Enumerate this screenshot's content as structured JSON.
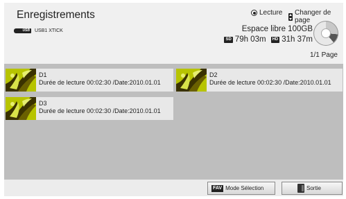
{
  "header": {
    "title": "Enregistrements",
    "hint_play": {
      "icon": "play-circle-icon",
      "label": "Lecture"
    },
    "hint_page": {
      "icon": "page-up-down-icon",
      "label": "Changer de page"
    },
    "usb": {
      "icon": "usb-icon",
      "icon_text": "USB",
      "label": "USB1 XTICK"
    },
    "storage": {
      "free_space": "Espace libre 100GB",
      "sd_badge": "SD",
      "sd_time": "79h 03m",
      "hd_badge": "HD",
      "hd_time": "31h 37m",
      "icon": "disk-usage-icon"
    },
    "page_indicator": "1/1 Page"
  },
  "recordings": [
    {
      "name": "D1",
      "detail": "Durée de lecture 00:02:30 /Date:2010.01.01"
    },
    {
      "name": "D2",
      "detail": "Durée de lecture 00:02:30 /Date:2010.01.01"
    },
    {
      "name": "D3",
      "detail": "Durée de lecture 00:02:30 /Date:2010.01.01"
    }
  ],
  "footer": {
    "fav_badge": "FAV",
    "fav_label": "Mode Sélection",
    "exit_icon": "exit-icon",
    "exit_label": "Sortie"
  },
  "colors": {
    "panel_bg": "#ececec",
    "list_bg": "#bebebe",
    "card_bg": "#e8e8e8",
    "thumb_green": "#a8b800",
    "thumb_dark": "#3a3200"
  }
}
